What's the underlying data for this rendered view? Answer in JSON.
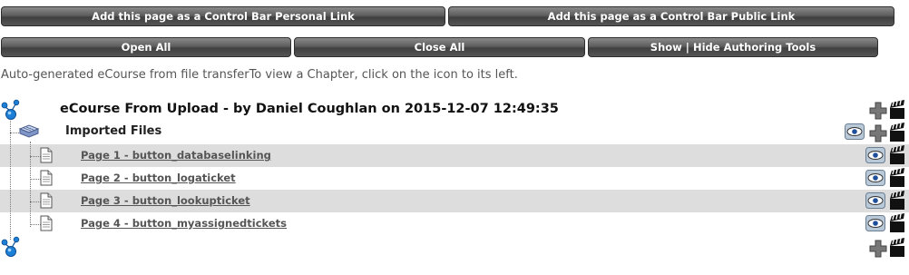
{
  "toolbar": {
    "personal_link_label": "Add this page as a Control Bar Personal Link",
    "public_link_label": "Add this page as a Control Bar Public Link",
    "open_all_label": "Open All",
    "close_all_label": "Close All",
    "authoring_tools_label": "Show | Hide Authoring Tools"
  },
  "intro_text": "Auto-generated eCourse from file transferTo view a Chapter, click on the icon to its left.",
  "course": {
    "title": "eCourse From Upload - by Daniel Coughlan on 2015-12-07 12:49:35",
    "folder": "Imported Files",
    "pages": [
      {
        "label": "Page 1 - button_databaselinking"
      },
      {
        "label": "Page 2 - button_logaticket"
      },
      {
        "label": "Page 3 - button_lookupticket"
      },
      {
        "label": "Page 4 - button_myassignedtickets"
      }
    ]
  },
  "icons": {
    "tree_root": "tree-root-icon",
    "folder": "chapter-book-icon",
    "page": "page-document-icon",
    "view": "eye-icon",
    "add": "plus-icon",
    "edit": "clapperboard-icon"
  },
  "colors": {
    "button_bg": "#5e5e5e",
    "row_shade": "#dddddd",
    "link": "#555555",
    "tree_blue": "#1d7fd6"
  }
}
